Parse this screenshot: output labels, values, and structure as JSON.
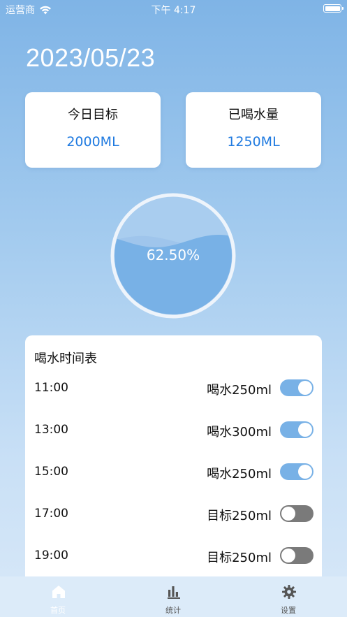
{
  "status_bar": {
    "carrier": "运营商",
    "time": "下午 4:17"
  },
  "date": "2023/05/23",
  "cards": {
    "goal": {
      "label": "今日目标",
      "value": "2000ML"
    },
    "drunk": {
      "label": "已喝水量",
      "value": "1250ML"
    }
  },
  "progress": {
    "text": "62.50%",
    "fraction": 0.625
  },
  "schedule": {
    "title": "喝水时间表",
    "rows": [
      {
        "time": "11:00",
        "label": "喝水250ml",
        "on": true
      },
      {
        "time": "13:00",
        "label": "喝水300ml",
        "on": true
      },
      {
        "time": "15:00",
        "label": "喝水250ml",
        "on": true
      },
      {
        "time": "17:00",
        "label": "目标250ml",
        "on": false
      },
      {
        "time": "19:00",
        "label": "目标250ml",
        "on": false
      }
    ]
  },
  "tabs": [
    {
      "label": "首页",
      "icon": "home-icon",
      "active": true
    },
    {
      "label": "统计",
      "icon": "bar-chart-icon",
      "active": false
    },
    {
      "label": "设置",
      "icon": "gear-icon",
      "active": false
    }
  ],
  "colors": {
    "accent": "#1f7ae0",
    "toggle_on": "#78b1e6",
    "toggle_off": "#7a7a7a",
    "water": "#78b1e6"
  }
}
